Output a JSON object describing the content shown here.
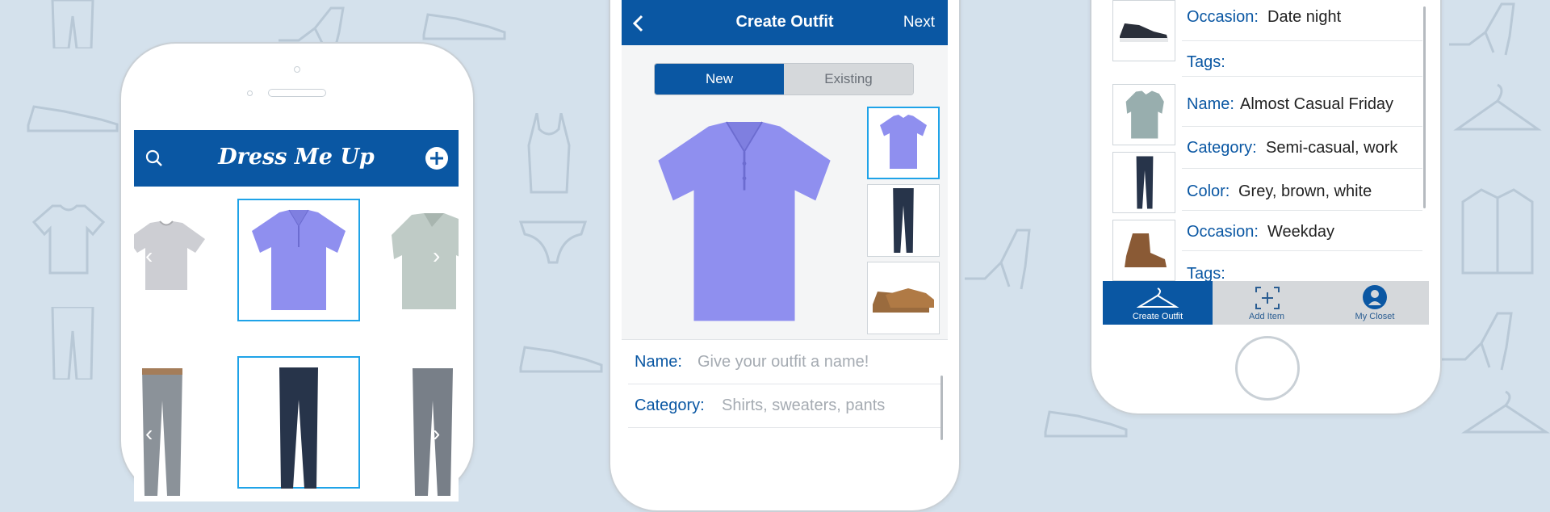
{
  "colors": {
    "brand_blue": "#0a57a3",
    "selection_cyan": "#1fa3e8",
    "background": "#d4e1ec",
    "field_label": "#0a57a3",
    "placeholder": "#a5abb2"
  },
  "screen1": {
    "title": "Dress Me Up",
    "search_icon": "search-icon",
    "add_icon": "plus-circle-icon",
    "row1": [
      "grey-tshirt",
      "purple-polo",
      "striped-shirt"
    ],
    "row2": [
      "grey-jeans",
      "dark-jeans",
      "grey-pants"
    ]
  },
  "screen2": {
    "back_icon": "chevron-left-icon",
    "title": "Create Outfit",
    "next_label": "Next",
    "segment": {
      "new_label": "New",
      "existing_label": "Existing",
      "selected": "New"
    },
    "fields": [
      {
        "label": "Name:",
        "placeholder": "Give your outfit a name!"
      },
      {
        "label": "Category:",
        "placeholder": "Shirts, sweaters, pants"
      }
    ]
  },
  "screen3": {
    "top_outfit": {
      "occasion_label": "Occasion:",
      "occasion_value": "Date night",
      "tags_label": "Tags:"
    },
    "outfit": {
      "name_label": "Name:",
      "name_value": "Almost Casual Friday",
      "category_label": "Category:",
      "category_value": "Semi-casual, work",
      "color_label": "Color:",
      "color_value": "Grey, brown, white",
      "occasion_label": "Occasion:",
      "occasion_value": "Weekday",
      "tags_label": "Tags:"
    },
    "tabbar": [
      {
        "label": "Create Outfit",
        "icon": "hanger-icon",
        "active": true
      },
      {
        "label": "Add Item",
        "icon": "add-frame-icon",
        "active": false
      },
      {
        "label": "My Closet",
        "icon": "profile-icon",
        "active": false
      }
    ]
  }
}
